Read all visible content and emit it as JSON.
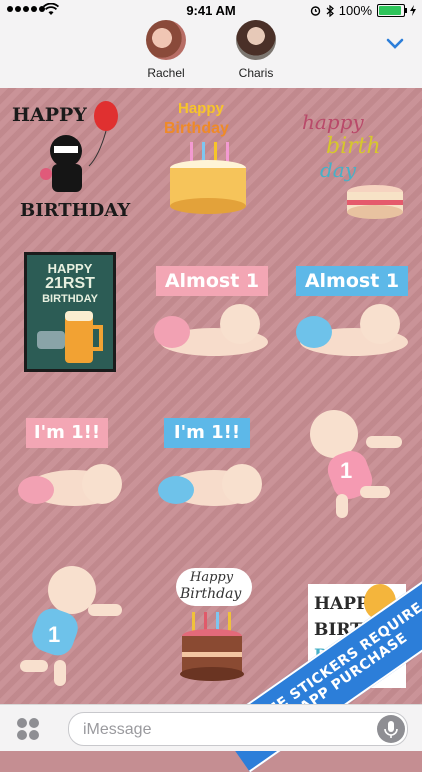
{
  "status": {
    "time": "9:41 AM",
    "battery": "100%"
  },
  "contacts": [
    {
      "name": "Rachel"
    },
    {
      "name": "Charis"
    }
  ],
  "stickers": {
    "s1": {
      "line1": "HAPPY",
      "line2": "BIRTHDAY"
    },
    "s2": {
      "line1": "Happy",
      "line2": "Birthday"
    },
    "s3": {
      "line1": "happy",
      "line2": "birth",
      "line3": "day"
    },
    "s4": {
      "line1": "HAPPY",
      "line2": "21RST",
      "line3": "BIRTHDAY"
    },
    "s5": {
      "label": "Almost 1"
    },
    "s6": {
      "label": "Almost 1"
    },
    "s7": {
      "label": "I'm 1!!"
    },
    "s8": {
      "label": "I'm 1!!"
    },
    "s9": {
      "number": "1"
    },
    "s10": {
      "number": "1"
    },
    "s11": {
      "line1": "Happy",
      "line2": "Birthday"
    },
    "s12": {
      "line1": "HAPPY",
      "line2": "BIRTH",
      "line3": "D"
    }
  },
  "input": {
    "placeholder": "iMessage"
  },
  "banner": {
    "line1": "SOME STICKERS REQUIRE",
    "line2": "IN-APP PURCHASE"
  },
  "colors": {
    "accent": "#2c7ed9",
    "background": "#c58e92",
    "pink_label": "#f3a6b4",
    "blue_label": "#5db8e8"
  }
}
